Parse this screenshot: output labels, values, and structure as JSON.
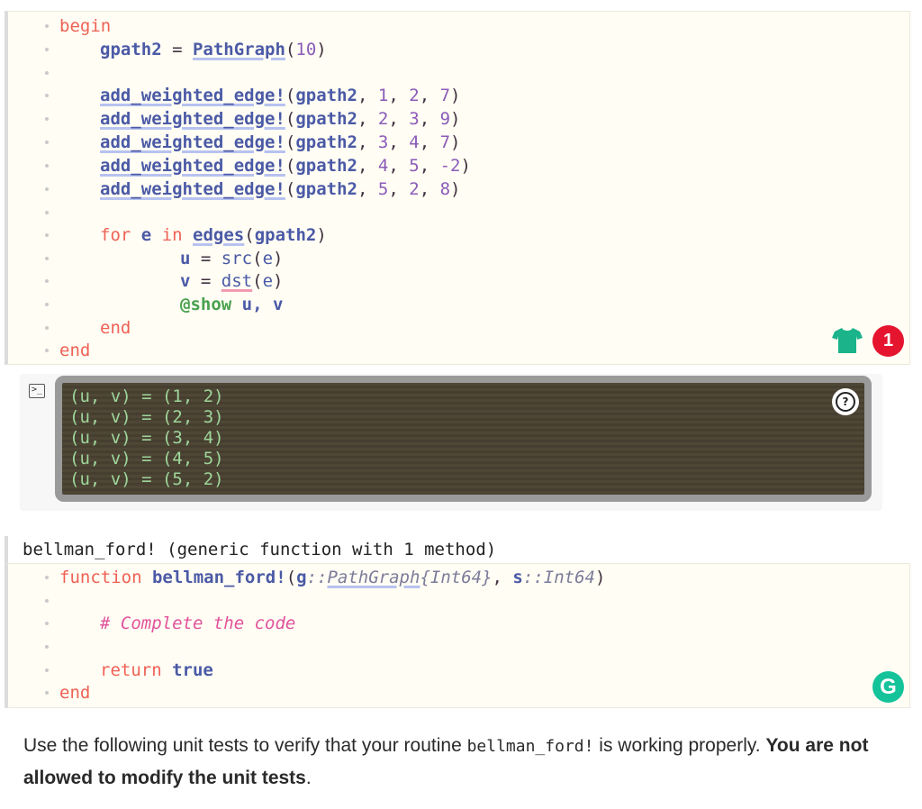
{
  "cell1": {
    "line1": {
      "kw": "begin"
    },
    "line2": {
      "var": "gpath2",
      "eq": " = ",
      "fn": "PathGraph",
      "open": "(",
      "arg": "10",
      "close": ")"
    },
    "edges": [
      {
        "fn": "add_weighted_edge!",
        "g": "gpath2",
        "a": "1",
        "b": "2",
        "w": "7"
      },
      {
        "fn": "add_weighted_edge!",
        "g": "gpath2",
        "a": "2",
        "b": "3",
        "w": "9"
      },
      {
        "fn": "add_weighted_edge!",
        "g": "gpath2",
        "a": "3",
        "b": "4",
        "w": "7"
      },
      {
        "fn": "add_weighted_edge!",
        "g": "gpath2",
        "a": "4",
        "b": "5",
        "w": "-2"
      },
      {
        "fn": "add_weighted_edge!",
        "g": "gpath2",
        "a": "5",
        "b": "2",
        "w": "8"
      }
    ],
    "for_line": {
      "for": "for",
      "e": "e",
      "in": "in",
      "fn": "edges",
      "arg": "gpath2"
    },
    "u_line": {
      "var": "u",
      "fn": "src",
      "arg": "e"
    },
    "v_line": {
      "var": "v",
      "fn": "dst",
      "arg": "e"
    },
    "show_line": {
      "macro": "@show",
      "args": "u, v"
    },
    "end_inner": "end",
    "end_outer": "end"
  },
  "output": {
    "lines": [
      "(u, v) = (1, 2)",
      "(u, v) = (2, 3)",
      "(u, v) = (3, 4)",
      "(u, v) = (4, 5)",
      "(u, v) = (5, 2)"
    ],
    "help_glyph": "?",
    "terminal_glyph": ">_"
  },
  "signature": "bellman_ford! (generic function with 1 method)",
  "cell2": {
    "func_kw": "function",
    "func_name": "bellman_ford!",
    "p1": "g",
    "sep": "::",
    "t1": "PathGraph",
    "t1_param": "{Int64}",
    "p2": "s",
    "t2": "Int64",
    "comment": "# Complete the code",
    "return_kw": "return",
    "return_val": "true",
    "end": "end"
  },
  "badge_count": "1",
  "grammarly_letter": "G",
  "paragraph": {
    "pre": "Use the following unit tests to verify that your routine ",
    "code": "bellman_ford!",
    "mid": " is working properly. ",
    "bold": "You are not allowed to modify the unit tests",
    "post": "."
  },
  "colors": {
    "badge": "#e5152f",
    "grammarly": "#15c39a",
    "shirt": "#1bb38a"
  }
}
